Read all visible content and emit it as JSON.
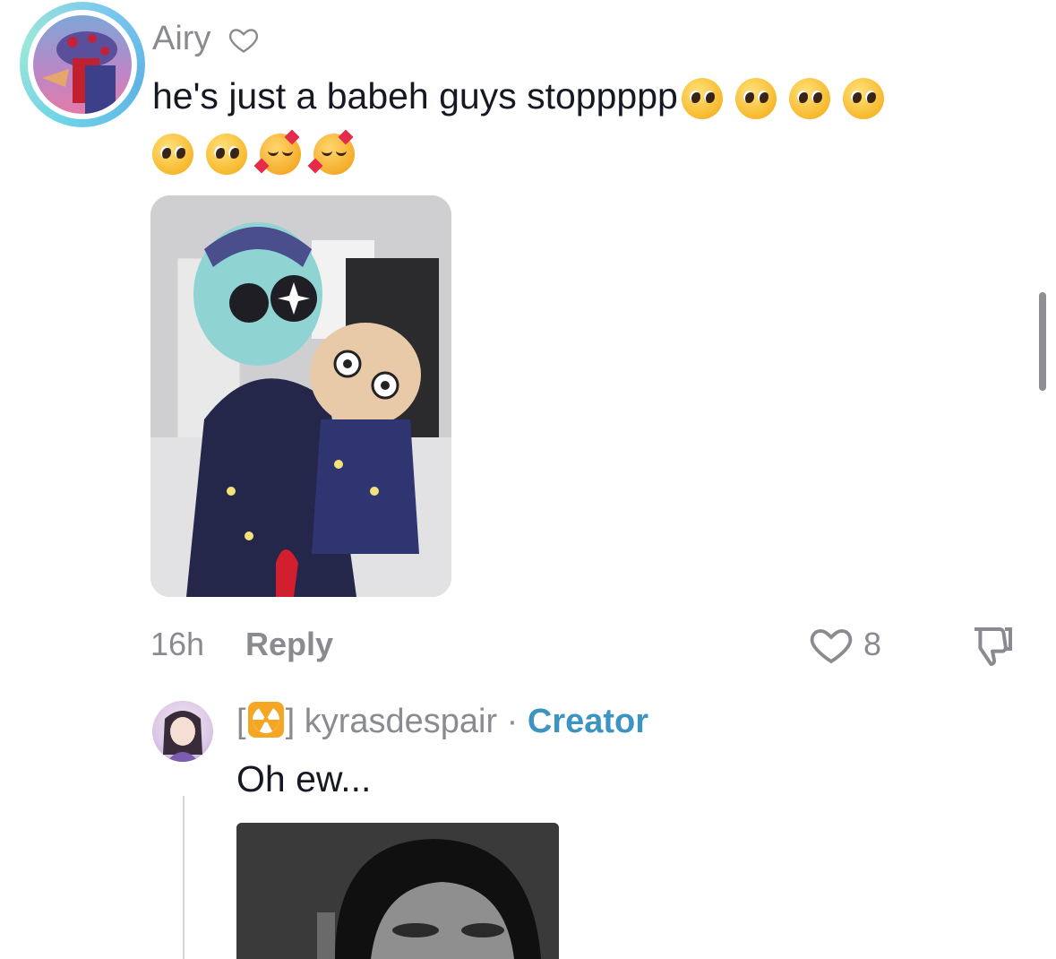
{
  "comment": {
    "username": "Airy",
    "text": "he's just a babeh guys stoppppp",
    "emojis_line1": [
      "pleading-face",
      "pleading-face",
      "pleading-face",
      "pleading-face"
    ],
    "emojis_line2": [
      "pleading-face",
      "pleading-face",
      "smiling-face-with-hearts",
      "smiling-face-with-hearts"
    ],
    "time": "16h",
    "reply_label": "Reply",
    "like_count": "8",
    "accent_colors": {
      "text_secondary": "#8a8b91",
      "text_primary": "#161823"
    }
  },
  "reply": {
    "badge_open": "[",
    "badge_close": "]",
    "badge_icon": "radioactive-icon",
    "username": "kyrasdespair",
    "separator": "·",
    "creator_label": "Creator",
    "text": "Oh ew...",
    "creator_color": "#3b94c2"
  }
}
